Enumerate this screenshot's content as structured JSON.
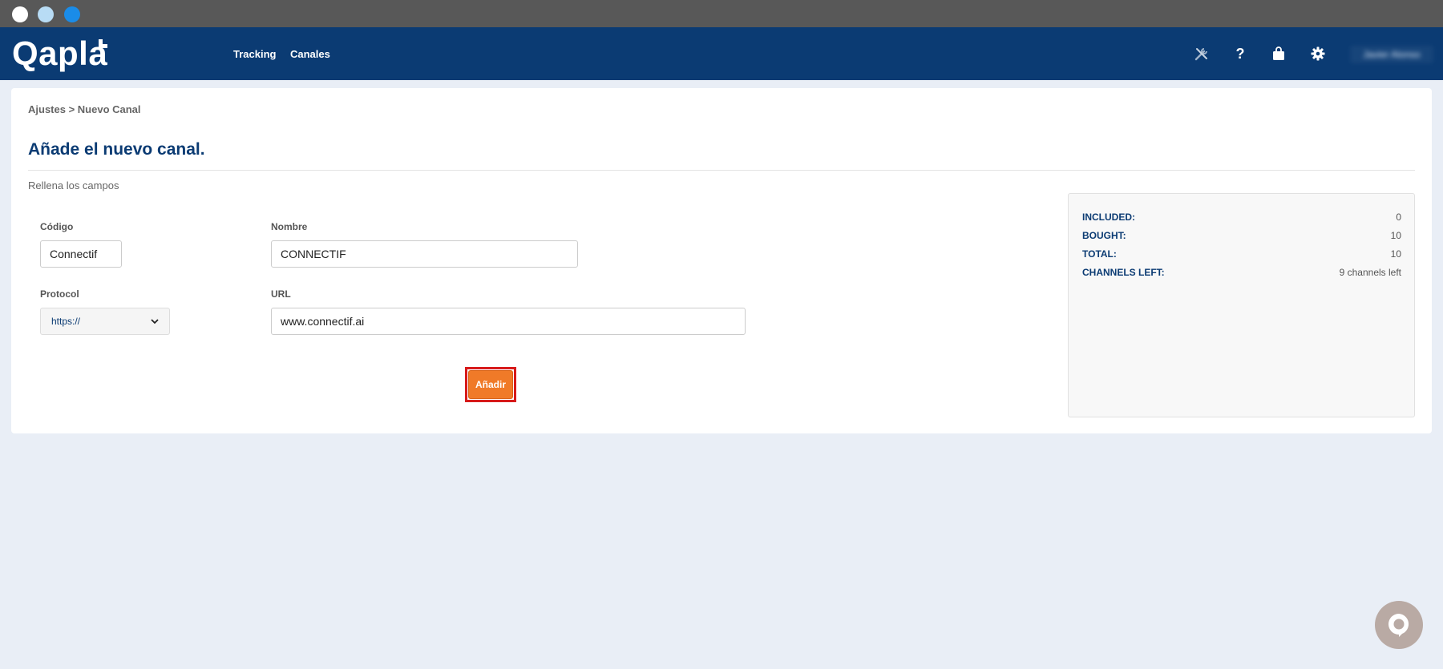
{
  "window": {
    "controls": [
      "close",
      "minimize",
      "maximize"
    ]
  },
  "navbar": {
    "logo": "Qapla",
    "links": {
      "tracking": "Tracking",
      "canales": "Canales"
    },
    "icons": [
      "tools-icon",
      "help-icon",
      "bag-icon",
      "gear-icon"
    ],
    "help_glyph": "?",
    "user_name": "Javier Alonso",
    "colors": {
      "background": "#0b3b73"
    }
  },
  "page": {
    "breadcrumb": "Ajustes > Nuevo Canal",
    "title": "Añade el nuevo canal.",
    "subtitle": "Rellena los campos"
  },
  "form": {
    "codigo": {
      "label": "Código",
      "value": "Connectif"
    },
    "nombre": {
      "label": "Nombre",
      "value": "CONNECTIF"
    },
    "protocol": {
      "label": "Protocol",
      "selected": "https://"
    },
    "url": {
      "label": "URL",
      "value": "www.connectif.ai"
    },
    "add_button": "Añadir",
    "colors": {
      "button": "#f07a28",
      "highlight": "#d71a1a"
    }
  },
  "stats": {
    "included": {
      "label": "INCLUDED:",
      "value": "0"
    },
    "bought": {
      "label": "BOUGHT:",
      "value": "10"
    },
    "total": {
      "label": "TOTAL:",
      "value": "10"
    },
    "channels_left": {
      "label": "CHANNELS LEFT:",
      "value": "9 channels left"
    }
  },
  "chat": {
    "icon": "chat-icon"
  }
}
